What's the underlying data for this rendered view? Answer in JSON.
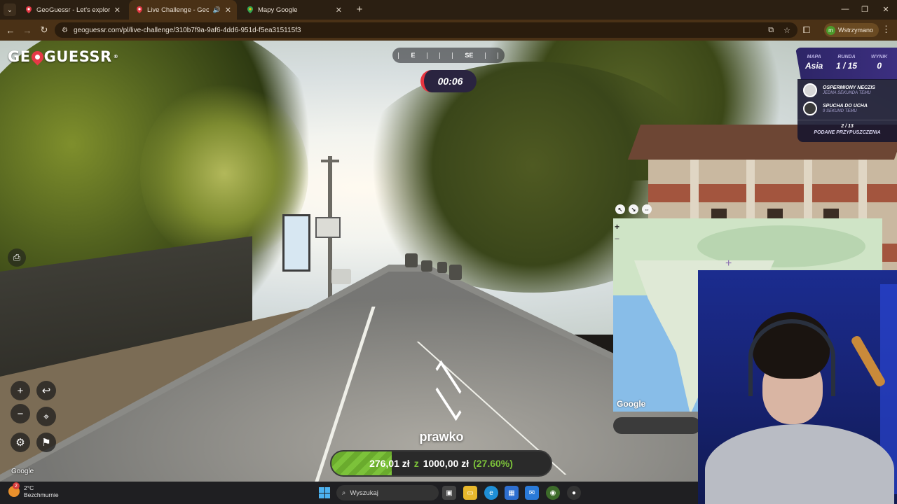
{
  "browser": {
    "tabs": [
      {
        "title": "GeoGuessr - Let's explore the w",
        "active": false
      },
      {
        "title": "Live Challenge - GeoGuessr",
        "active": true
      },
      {
        "title": "Mapy Google",
        "active": false
      }
    ],
    "url": "geoguessr.com/pl/live-challenge/310b7f9a-9af6-4dd6-951d-f5ea315115f3",
    "profile_label": "Wstrzymano",
    "profile_initial": "m"
  },
  "game": {
    "logo_text_left": "GE",
    "logo_text_right": "GUESSR",
    "logo_reg": "®",
    "compass_labels": [
      "E",
      "SE"
    ],
    "timer": "00:06",
    "status": {
      "map_label": "MAPA",
      "map_value": "Asia",
      "round_label": "RUNDA",
      "round_value": "1 / 15",
      "score_label": "WYNIK",
      "score_value": "0"
    },
    "players": [
      {
        "name": "OSPERMIONY NECZIS",
        "time": "JEDNA SEKUNDA TEMU"
      },
      {
        "name": "SPUCHA DO UCHA",
        "time": "9 SEKUND TEMU"
      }
    ],
    "guess_count": "2 / 13",
    "guess_label": "PODANE PRZYPUSZCZENIA",
    "google_mark": "Google",
    "map_google_mark": "Google",
    "map_zoom_in": "+",
    "map_zoom_out": "−"
  },
  "stream": {
    "username": "prawko",
    "donation": {
      "current": "276,01 zł",
      "joiner": "z",
      "goal": "1000,00 zł",
      "percent_text": "(27.60%)",
      "progress": 0.276
    }
  },
  "taskbar": {
    "weather_temp": "2°C",
    "weather_desc": "Bezchmurnie",
    "weather_badge": "2",
    "search_placeholder": "Wyszukaj"
  }
}
